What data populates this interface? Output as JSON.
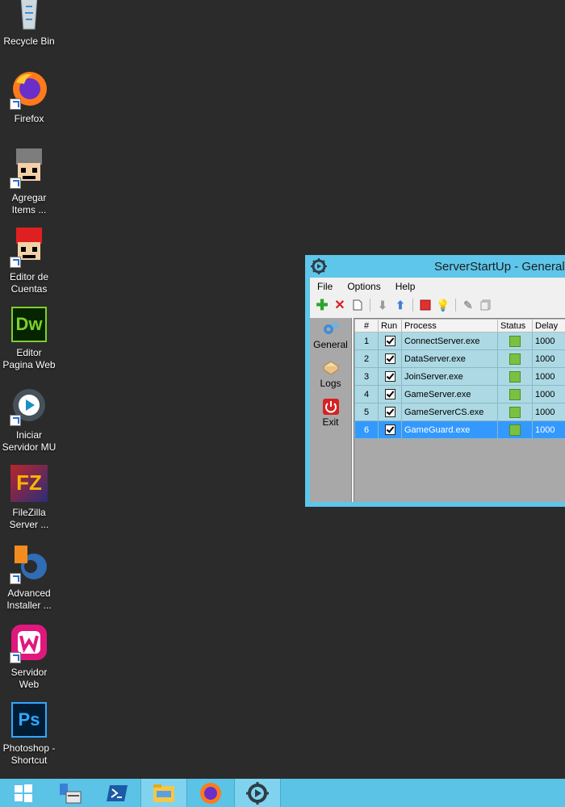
{
  "desktop": {
    "icons": [
      {
        "label": "Recycle Bin",
        "icon": "recycle-bin-icon"
      },
      {
        "label": "Firefox",
        "icon": "firefox-icon"
      },
      {
        "label": "Agregar Items ...",
        "icon": "agregar-items-icon"
      },
      {
        "label": "Editor de Cuentas",
        "icon": "editor-cuentas-icon"
      },
      {
        "label": "Editor Pagina Web",
        "icon": "dreamweaver-icon"
      },
      {
        "label": "Iniciar Servidor MU",
        "icon": "iniciar-servidor-icon"
      },
      {
        "label": "FileZilla Server ...",
        "icon": "filezilla-icon"
      },
      {
        "label": "Advanced Installer ...",
        "icon": "advanced-installer-icon"
      },
      {
        "label": "Servidor Web",
        "icon": "wamp-icon"
      },
      {
        "label": "Photoshop - Shortcut",
        "icon": "photoshop-icon"
      }
    ],
    "dw_text": "Dw",
    "ps_text": "Ps",
    "fz_text": "FZ"
  },
  "window": {
    "title": "ServerStartUp - General ©",
    "menu": [
      "File",
      "Options",
      "Help"
    ],
    "sidebar": [
      {
        "label": "General",
        "icon": "gears-icon"
      },
      {
        "label": "Logs",
        "icon": "logs-icon"
      },
      {
        "label": "Exit",
        "icon": "power-icon"
      }
    ],
    "columns": [
      "#",
      "Run",
      "Process",
      "Status",
      "Delay"
    ],
    "rows": [
      {
        "num": "1",
        "process": "ConnectServer.exe",
        "delay": "1000"
      },
      {
        "num": "2",
        "process": "DataServer.exe",
        "delay": "1000"
      },
      {
        "num": "3",
        "process": "JoinServer.exe",
        "delay": "1000"
      },
      {
        "num": "4",
        "process": "GameServer.exe",
        "delay": "1000"
      },
      {
        "num": "5",
        "process": "GameServerCS.exe",
        "delay": "1000"
      },
      {
        "num": "6",
        "process": "GameGuard.exe",
        "delay": "1000"
      }
    ],
    "selected_row": 6
  },
  "colors": {
    "desktop_bg": "#2b2b2b",
    "taskbar": "#5bc3e6",
    "window_frame": "#5ec6ea",
    "row_bg": "#acd9e4",
    "row_selected": "#3399ff",
    "status_ok": "#7ac143"
  }
}
